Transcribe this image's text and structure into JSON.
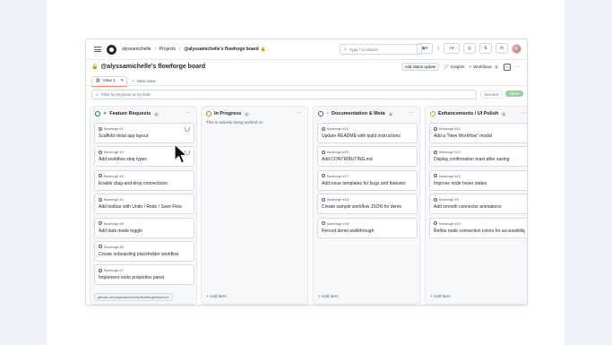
{
  "breadcrumb": {
    "user": "alyssamichelle",
    "projects": "Projects",
    "board": "@alyssamichelle's flowforge board"
  },
  "search": {
    "placeholder": "Type / to search"
  },
  "project": {
    "title": "@alyssamichelle's flowforge board",
    "add_status": "Add status update",
    "insights": "Insights",
    "workflows": "Workflows",
    "workflows_count": "4"
  },
  "views": {
    "view1": "View 1",
    "new_view": "New view"
  },
  "filter": {
    "placeholder": "Filter by keyword or by field",
    "discard": "Discard",
    "save": "Save"
  },
  "columns": [
    {
      "name": "Feature Requests",
      "count": "8",
      "color": "#1a7f37",
      "cards": [
        {
          "ref": "flowforge #1",
          "title": "Scaffold initial app layout"
        },
        {
          "ref": "flowforge #2",
          "title": "Add workflow step types"
        },
        {
          "ref": "flowforge #3",
          "title": "Enable drag-and-drop connections"
        },
        {
          "ref": "flowforge #4",
          "title": "Add toolbar with Undo / Redo / Save Flow"
        },
        {
          "ref": "flowforge #5",
          "title": "Add dark mode toggle"
        },
        {
          "ref": "flowforge #6",
          "title": "Create onboarding placeholder workflow"
        },
        {
          "ref": "flowforge #7",
          "title": "Implement node properties panel"
        }
      ]
    },
    {
      "name": "In Progress",
      "count": "0",
      "color": "#bf8700",
      "subtitle": "This is actively being worked on",
      "cards": []
    },
    {
      "name": "Documentation & Meta",
      "count": "5",
      "color": "#57606a",
      "cards": [
        {
          "ref": "flowforge #14",
          "title": "Update README with build instructions"
        },
        {
          "ref": "flowforge #15",
          "title": "Add CONTRIBUTING.md"
        },
        {
          "ref": "flowforge #17",
          "title": "Add issue templates for bugs and features"
        },
        {
          "ref": "flowforge #16",
          "title": "Create sample workflow JSON for demo"
        },
        {
          "ref": "flowforge #18",
          "title": "Record demo walkthrough"
        }
      ]
    },
    {
      "name": "Enhancements / UI Polish",
      "count": "5",
      "color": "#d4a72c",
      "cards": [
        {
          "ref": "flowforge #11",
          "title": "Add a \"New Workflow\" modal"
        },
        {
          "ref": "flowforge #12",
          "title": "Display confirmation toast after saving"
        },
        {
          "ref": "flowforge #10",
          "title": "Improve node hover states"
        },
        {
          "ref": "flowforge #9",
          "title": "Add smooth connector animations"
        },
        {
          "ref": "flowforge #13",
          "title": "Refine node connection colors for accessibility"
        }
      ]
    }
  ],
  "add_item_label": "Add item",
  "url_tooltip": "github.com/alyssamichelle/flowforge/issues/1"
}
